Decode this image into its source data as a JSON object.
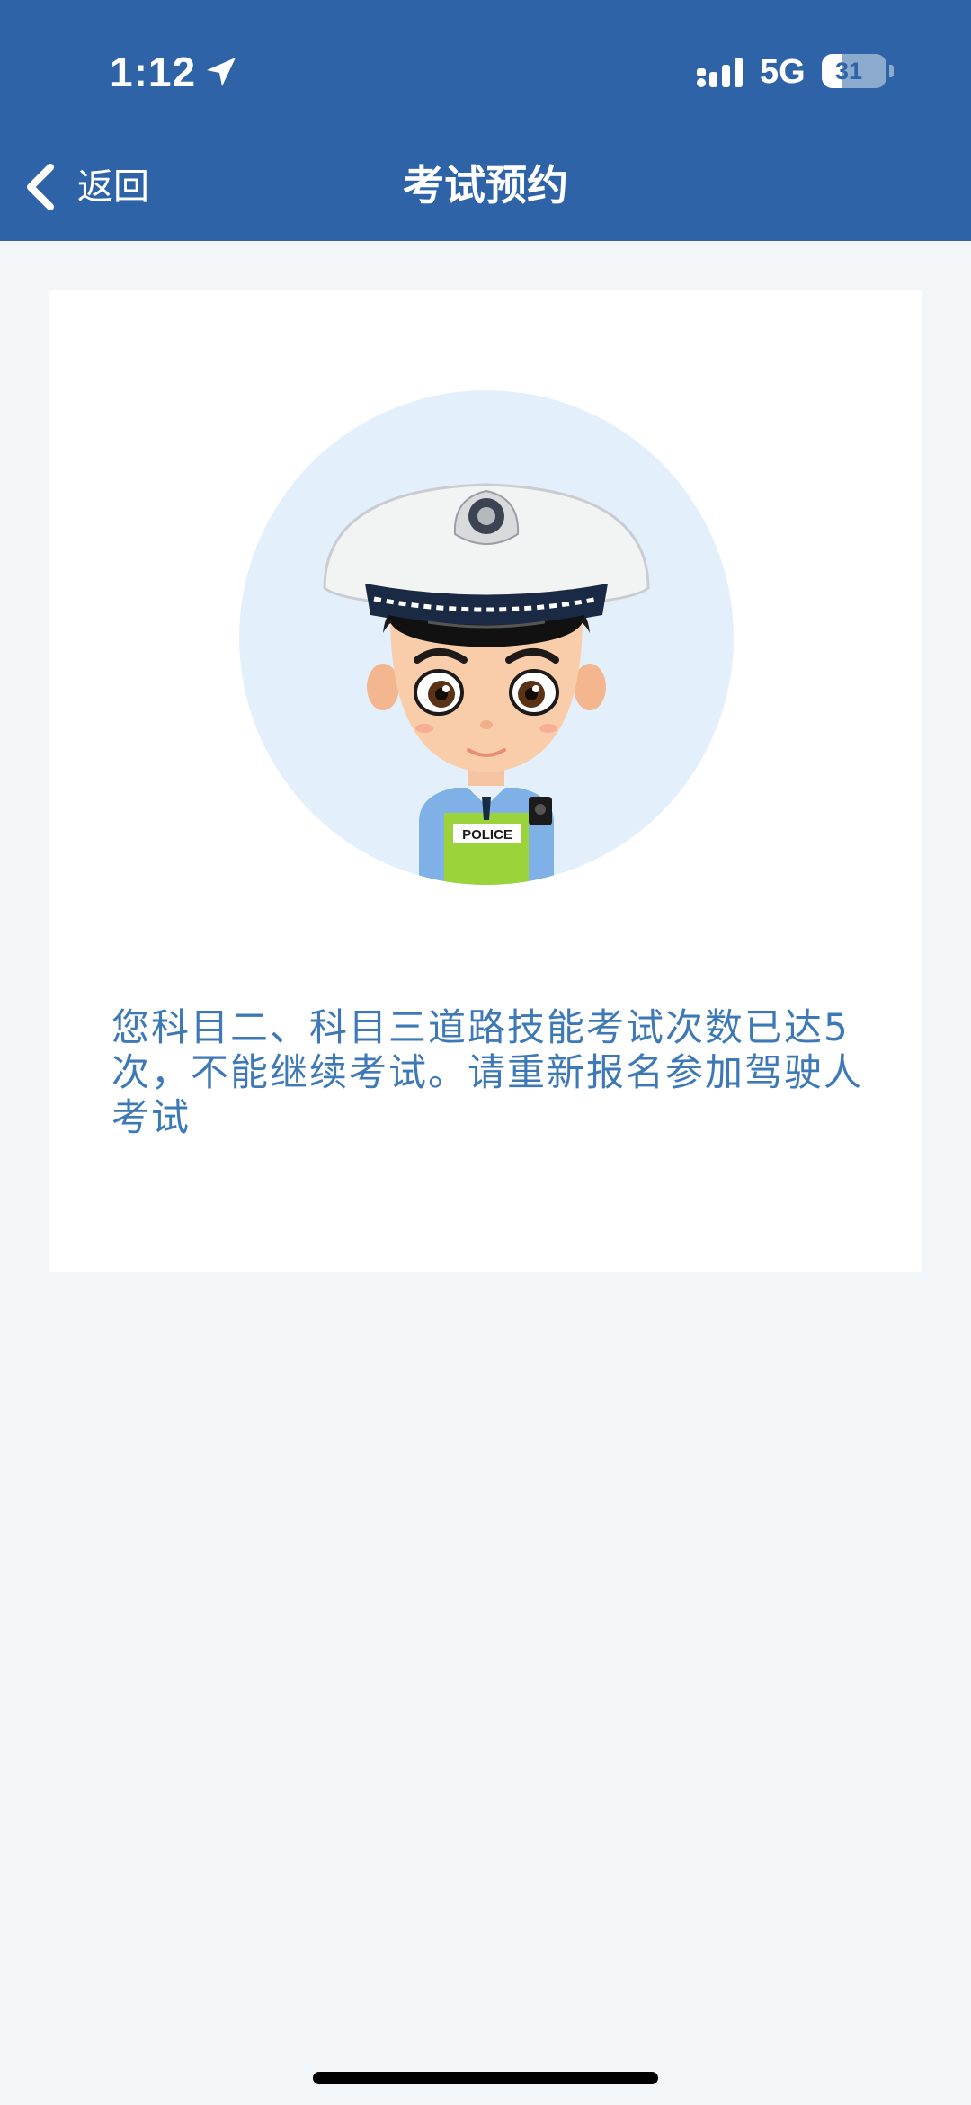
{
  "status_bar": {
    "time": "1:12",
    "network": "5G",
    "battery_level": "31",
    "battery_fraction": 0.31
  },
  "nav": {
    "back_label": "返回",
    "title": "考试预约"
  },
  "card": {
    "avatar_badge": "POLICE",
    "message": "您科目二、科目三道路技能考试次数已达5次，不能继续考试。请重新报名参加驾驶人考试"
  },
  "colors": {
    "header": "#2e64a7",
    "message_text": "#3d79b6",
    "avatar_bg": "#e3f0fb",
    "page_bg": "#f3f6f8"
  },
  "icons": {
    "back": "chevron-left-icon",
    "location": "location-arrow-icon",
    "signal": "cellular-signal-icon",
    "battery": "battery-icon",
    "avatar": "police-officer-avatar"
  }
}
